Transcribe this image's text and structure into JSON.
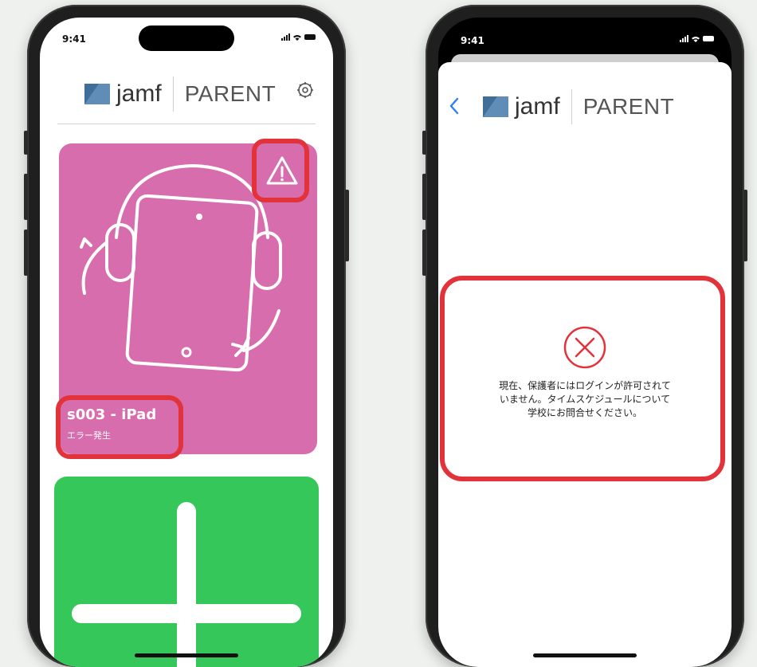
{
  "status_bar": {
    "time": "9:41"
  },
  "brand": {
    "wordmark": "jamf",
    "product": "PARENT"
  },
  "left_screen": {
    "device_card": {
      "name": "s003 - iPad",
      "status": "エラー発生",
      "card_color": "#d86dad"
    },
    "add_card": {
      "card_color": "#35c75a"
    }
  },
  "right_screen": {
    "back_label": "<",
    "message_lines": [
      "現在、保護者にはログインが許可されて",
      "いません。タイムスケジュールについて",
      "学校にお問合せください。"
    ]
  },
  "colors": {
    "highlight": "#e2333b",
    "back": "#2f7ff5",
    "error": "#e2333b"
  },
  "icons": [
    "warning-icon",
    "settings-icon",
    "back-chevron-icon",
    "error-circle-x-icon",
    "plus-icon",
    "ipad-headphones-illustration"
  ]
}
